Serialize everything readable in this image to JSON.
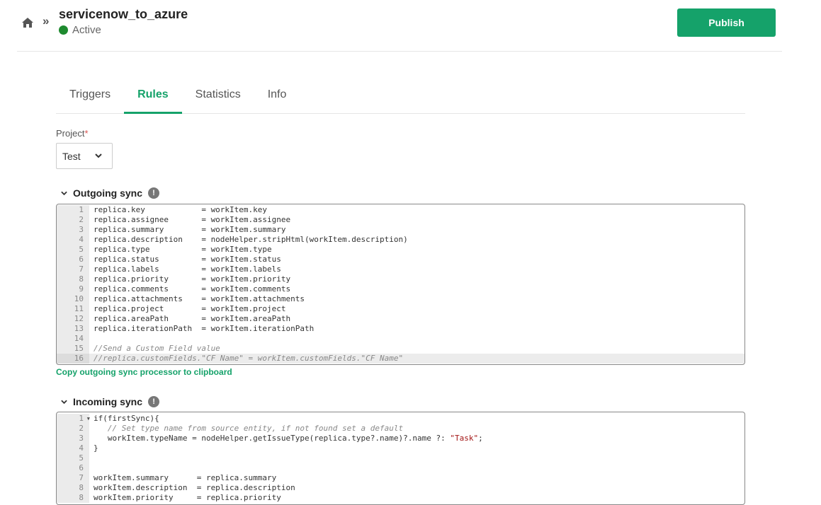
{
  "header": {
    "breadcrumb_separator": "»",
    "connection_name": "servicenow_to_azure",
    "status": "Active",
    "status_color": "#1e8a2f",
    "publish_label": "Publish",
    "accent_color": "#15a26a"
  },
  "tabs": [
    {
      "label": "Triggers",
      "active": false
    },
    {
      "label": "Rules",
      "active": true
    },
    {
      "label": "Statistics",
      "active": false
    },
    {
      "label": "Info",
      "active": false
    }
  ],
  "project": {
    "label": "Project",
    "required_mark": "*",
    "selected": "Test"
  },
  "outgoing": {
    "title": "Outgoing sync",
    "copy_link": "Copy outgoing sync processor to clipboard",
    "lines": [
      "replica.key            = workItem.key",
      "replica.assignee       = workItem.assignee",
      "replica.summary        = workItem.summary",
      "replica.description    = nodeHelper.stripHtml(workItem.description)",
      "replica.type           = workItem.type",
      "replica.status         = workItem.status",
      "replica.labels         = workItem.labels",
      "replica.priority       = workItem.priority",
      "replica.comments       = workItem.comments",
      "replica.attachments    = workItem.attachments",
      "replica.project        = workItem.project",
      "replica.areaPath       = workItem.areaPath",
      "replica.iterationPath  = workItem.iterationPath",
      "",
      "//Send a Custom Field value",
      "//replica.customFields.\"CF Name\" = workItem.customFields.\"CF Name\""
    ]
  },
  "incoming": {
    "title": "Incoming sync",
    "line1": "if(firstSync){",
    "line2": "   // Set type name from source entity, if not found set a default",
    "line3_pre": "   workItem.typeName = nodeHelper.getIssueType(replica.type?.name)?.name ?: ",
    "line3_str": "\"Task\"",
    "line3_post": ";",
    "line4": "}",
    "line5": "",
    "line6": "",
    "line7": "workItem.summary      = replica.summary",
    "line8": "workItem.description  = replica.description",
    "line9": "workItem.priority     = replica.priority"
  }
}
